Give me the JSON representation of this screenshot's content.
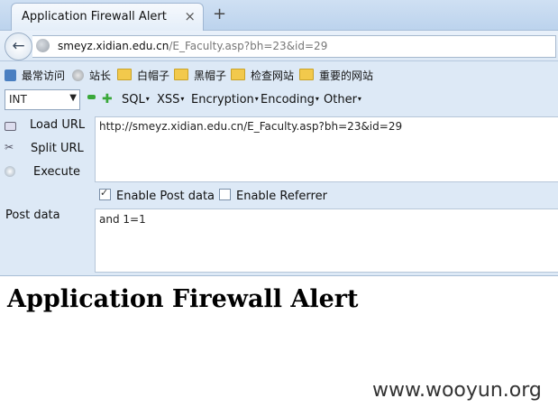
{
  "tab": {
    "title": "Application Firewall Alert",
    "close_glyph": "×",
    "newtab_glyph": "+"
  },
  "nav": {
    "back_glyph": "←",
    "url_domain": "smeyz.xidian.edu.cn",
    "url_path": "/E_Faculty.asp?bh=23&id=29"
  },
  "bookmarks": [
    {
      "label": "最常访问",
      "icon": "star-folder-icon"
    },
    {
      "label": "站长",
      "icon": "globe-icon"
    },
    {
      "label": "白帽子",
      "icon": "folder-icon"
    },
    {
      "label": "黑帽子",
      "icon": "folder-icon"
    },
    {
      "label": "检查网站",
      "icon": "folder-icon"
    },
    {
      "label": "重要的网站",
      "icon": "folder-icon"
    }
  ],
  "hackbar": {
    "select_value": "INT",
    "menus": [
      "SQL",
      "XSS",
      "Encryption",
      "Encoding",
      "Other"
    ],
    "actions": [
      "Load URL",
      "Split URL",
      "Execute"
    ],
    "url_value": "http://smeyz.xidian.edu.cn/E_Faculty.asp?bh=23&id=29",
    "enable_post_label": "Enable Post data",
    "enable_post_checked": true,
    "enable_referrer_label": "Enable Referrer",
    "enable_referrer_checked": false,
    "post_label": "Post data",
    "post_value": "and 1=1"
  },
  "page": {
    "heading": "Application Firewall Alert"
  },
  "watermark": "www.wooyun.org"
}
